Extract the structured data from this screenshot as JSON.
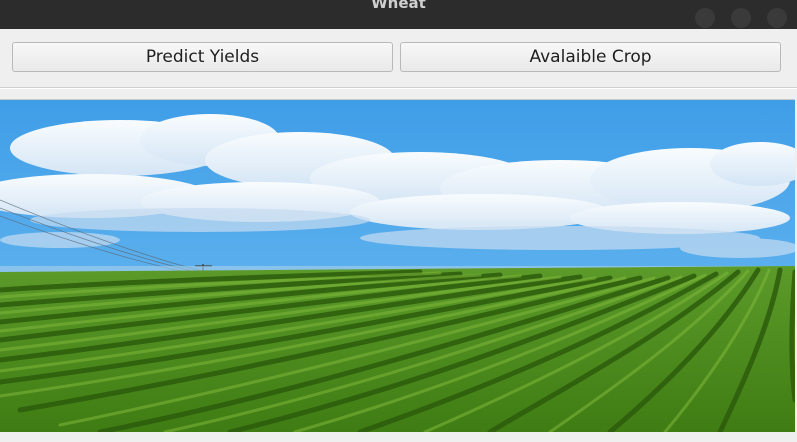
{
  "window": {
    "title": "Wheat"
  },
  "toolbar": {
    "predict_label": "Predict Yields",
    "crop_label": "Avalaible Crop"
  },
  "image": {
    "subject": "green crop field rows under blue sky with clouds"
  },
  "colors": {
    "titlebar": "#2c2c2c",
    "window_bg": "#efefef",
    "button_border": "#b9b9b9",
    "sky": "#4ea8e8",
    "field": "#4a8a1c"
  }
}
